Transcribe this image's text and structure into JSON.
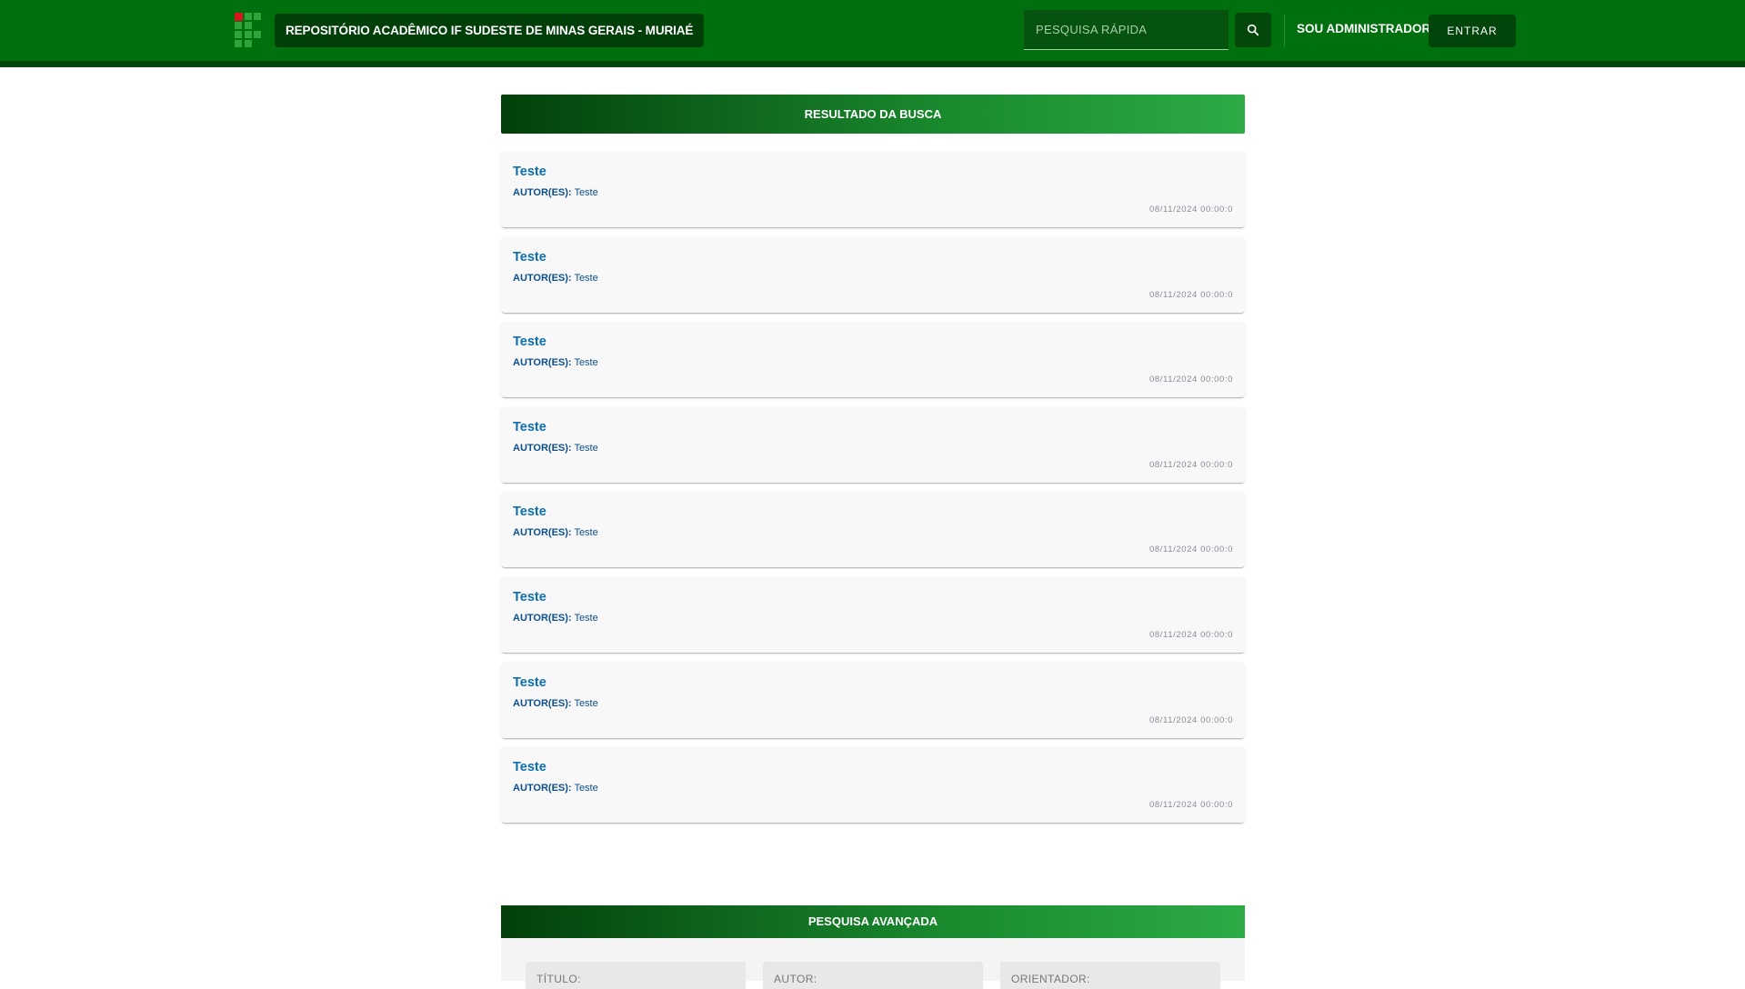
{
  "header": {
    "site_title": "REPOSITÓRIO ACADÊMICO IF SUDESTE DE MINAS GERAIS - MURIAÉ",
    "search_placeholder": "PESQUISA RÁPIDA",
    "admin_label": "SOU ADMINISTRADOR:",
    "enter_label": "ENTRAR",
    "brand_colors": {
      "green": "#00700e",
      "dark_green": "#02450b",
      "logo_red": "#d5161e"
    }
  },
  "results": {
    "heading": "RESULTADO DA BUSCA",
    "author_prefix": "AUTOR(ES):",
    "items": [
      {
        "title": "Teste",
        "authors": "Teste",
        "date": "08/11/2024 00:00:0"
      },
      {
        "title": "Teste",
        "authors": "Teste",
        "date": "08/11/2024 00:00:0"
      },
      {
        "title": "Teste",
        "authors": "Teste",
        "date": "08/11/2024 00:00:0"
      },
      {
        "title": "Teste",
        "authors": "Teste",
        "date": "08/11/2024 00:00:0"
      },
      {
        "title": "Teste",
        "authors": "Teste",
        "date": "08/11/2024 00:00:0"
      },
      {
        "title": "Teste",
        "authors": "Teste",
        "date": "08/11/2024 00:00:0"
      },
      {
        "title": "Teste",
        "authors": "Teste",
        "date": "08/11/2024 00:00:0"
      },
      {
        "title": "Teste",
        "authors": "Teste",
        "date": "08/11/2024 00:00:0"
      }
    ]
  },
  "advanced_search": {
    "heading": "PESQUISA AVANÇADA",
    "fields": [
      {
        "label": "TÍTULO:"
      },
      {
        "label": "AUTOR:"
      },
      {
        "label": "ORIENTADOR:"
      }
    ]
  },
  "icons": {
    "search": "search-icon",
    "logo": "if-logo-icon"
  }
}
